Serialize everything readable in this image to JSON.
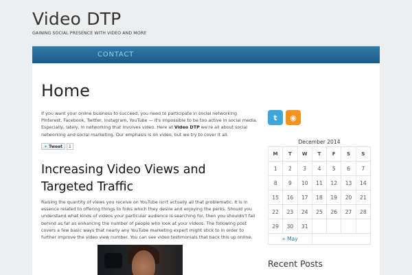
{
  "site": {
    "title": "Video DTP",
    "tagline": "GAINING SOCIAL PRESENCE WITH VIDEO AND MORE"
  },
  "nav": {
    "items": [
      {
        "label": "CONTACT"
      }
    ]
  },
  "page": {
    "title": "Home",
    "intro_part1": "If you want your online business to succeed, you need to participate in social networking. Pinterest, Facebook, Twitter, Instagram, YouTube — it's impossible to be too active in social media. Especially, lately, in networking that involves video. Here at ",
    "intro_bold": "Video DTP",
    "intro_part2": " we're all about social networking and social marketing. Our emphasis is on video, but we try to cover it all.",
    "tweet_label": "Tweet",
    "tweet_count": "1"
  },
  "post": {
    "title": "Increasing Video Views and Targeted Traffic",
    "body": "Raising the quantity of views you receive on YouTube isn't actually all that problematic. It is in essence related to offering things to folks which they desire and enjoying the perks. Should you understand what kinds of videos your particular audience is searching for, then you shouldn't fall behind as far as enhancing the number of people who look at your videos. The following post covers a few basic ways that nearly any YouTube marketing expert might stick to in order to further improve the video view number. You can see video testimonials that back this up online."
  },
  "sidebar": {
    "icons": [
      {
        "name": "twitter-icon",
        "glyph": "t",
        "color": "#3ea6d9"
      },
      {
        "name": "rss-icon",
        "glyph": "◉",
        "color": "#f3921d"
      }
    ],
    "calendar": {
      "caption": "December 2014",
      "days": [
        "M",
        "T",
        "W",
        "T",
        "F",
        "S",
        "S"
      ],
      "weeks": [
        [
          "1",
          "2",
          "3",
          "4",
          "5",
          "6",
          "7"
        ],
        [
          "8",
          "9",
          "10",
          "11",
          "12",
          "13",
          "14"
        ],
        [
          "15",
          "16",
          "17",
          "18",
          "19",
          "20",
          "21"
        ],
        [
          "22",
          "23",
          "24",
          "25",
          "26",
          "27",
          "28"
        ],
        [
          "29",
          "30",
          "31",
          "",
          "",
          "",
          ""
        ]
      ],
      "prev_label": "« May"
    },
    "recent_posts_heading": "Recent Posts"
  }
}
